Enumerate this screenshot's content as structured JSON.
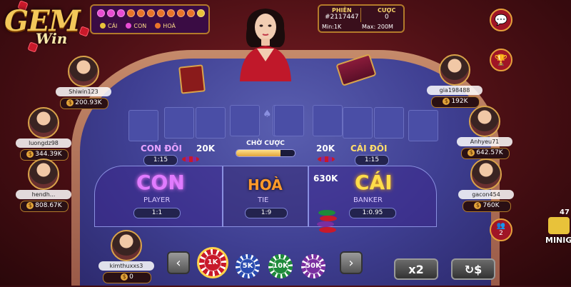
{
  "logo": {
    "brand": "GEM",
    "sub": "Win"
  },
  "road": {
    "dots": [
      "#e74cd4",
      "#e74cd4",
      "#e74cd4",
      "#e8742a",
      "#e8742a",
      "#e8742a",
      "#e8742a",
      "#e8742a",
      "#e8742a",
      "#e8742a",
      "#e8c23a"
    ],
    "legend": [
      {
        "label": "CÁI",
        "color": "#e8c23a"
      },
      {
        "label": "CON",
        "color": "#e74cd4"
      },
      {
        "label": "HOÀ",
        "color": "#e8742a"
      }
    ]
  },
  "info": {
    "session_label": "PHIÊN",
    "session_value": "#2117447",
    "bet_label": "CƯỢC",
    "bet_value": "0",
    "min_label": "Min:",
    "min_value": "1K",
    "max_label": "Max:",
    "max_value": "200M"
  },
  "players": [
    {
      "name": "Shiwin123",
      "money": "200.93K"
    },
    {
      "name": "luongdz98",
      "money": "344.39K"
    },
    {
      "name": "hendh...",
      "money": "808.67K"
    },
    {
      "name": "kimthuxxs3",
      "money": "0"
    },
    {
      "name": "gia198488",
      "money": "192K"
    },
    {
      "name": "Anhyeu71",
      "money": "642.57K"
    },
    {
      "name": "gacon454",
      "money": "760K"
    }
  ],
  "currency_symbol": "$",
  "status": {
    "text": "CHỜ CƯỢC",
    "progress": 0.75
  },
  "side_bets": {
    "con_doi": {
      "label": "CON ĐÔI",
      "amount": "20K",
      "ratio": "1:15"
    },
    "cai_doi": {
      "label": "CÁI ĐÔI",
      "amount": "20K",
      "ratio": "1:15"
    }
  },
  "main_bets": {
    "con": {
      "label": "CON",
      "sub": "PLAYER",
      "ratio": "1:1"
    },
    "hoa": {
      "label": "HOÀ",
      "sub": "TIE",
      "ratio": "1:9"
    },
    "cai": {
      "label": "CÁI",
      "sub": "BANKER",
      "ratio": "1:0.95",
      "amount": "630K"
    }
  },
  "chips": [
    {
      "label": "1K",
      "color": "#c8192a",
      "selected": true
    },
    {
      "label": "5K",
      "color": "#2a4bb0",
      "selected": false
    },
    {
      "label": "10K",
      "color": "#1e8a3a",
      "selected": false
    },
    {
      "label": "50K",
      "color": "#7a2fa0",
      "selected": false
    }
  ],
  "actions": {
    "double": "x2",
    "rebet": "↻$"
  },
  "right_buttons": {
    "online_count": "2",
    "minigame_label": "MINIG",
    "minigame_count": "47"
  }
}
